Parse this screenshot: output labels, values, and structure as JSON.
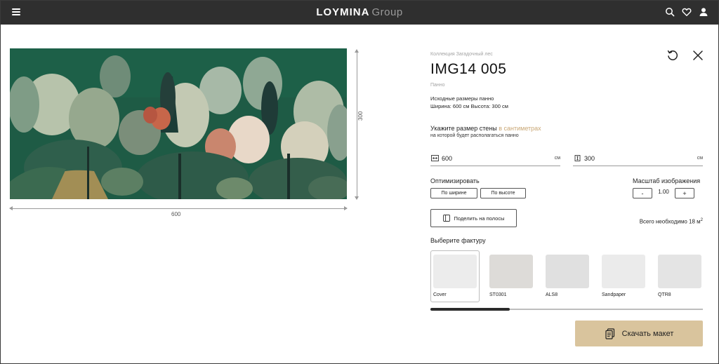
{
  "header": {
    "brand": "LOYMINA",
    "group": "Group"
  },
  "colors": {
    "header_bg": "#2f2f2f",
    "accent": "#c9a775",
    "download_bg": "#d9c49d",
    "mural_bg": "#1f5a44"
  },
  "icons": {
    "menu": "hamburger-icon",
    "search": "search-icon",
    "favorites": "heart-icon",
    "account": "user-icon",
    "reset": "rotate-icon",
    "close": "close-icon",
    "width": "width-icon",
    "height": "height-icon",
    "split": "split-columns-icon",
    "download": "document-stack-icon"
  },
  "preview": {
    "width_label": "600",
    "height_label": "300"
  },
  "product": {
    "collection": "Коллекция Загадочный лес",
    "title": "IMG14 005",
    "type": "Панно",
    "original_title": "Исходные размеры панно",
    "original_dims": "Ширина: 600 см Высота: 300 см"
  },
  "wall": {
    "prompt": "Укажите размер стены",
    "prompt_accent": "в сантиметрах",
    "sub": "на которой будет располагаться панно",
    "width_value": "600",
    "height_value": "300",
    "unit": "см"
  },
  "optimize": {
    "label": "Оптимизировать",
    "by_width": "По ширине",
    "by_height": "По высоте"
  },
  "scale": {
    "label": "Масштаб изображения",
    "minus": "-",
    "value": "1.00",
    "plus": "+"
  },
  "split": {
    "label": "Поделить на полосы"
  },
  "total": {
    "label": "Всего необходимо",
    "amount": "18 м",
    "power": "2"
  },
  "texture": {
    "label": "Выберите фактуру",
    "items": [
      {
        "name": "Cover",
        "color": "#ececec",
        "selected": true
      },
      {
        "name": "ST0301",
        "color": "#dddbd8",
        "selected": false
      },
      {
        "name": "ALS8",
        "color": "#e0e0e0",
        "selected": false
      },
      {
        "name": "Sandpaper",
        "color": "#ebebeb",
        "selected": false
      },
      {
        "name": "QTR8",
        "color": "#e4e4e4",
        "selected": false
      }
    ],
    "scroll_fraction": 0.29
  },
  "download": {
    "label": "Скачать макет"
  }
}
